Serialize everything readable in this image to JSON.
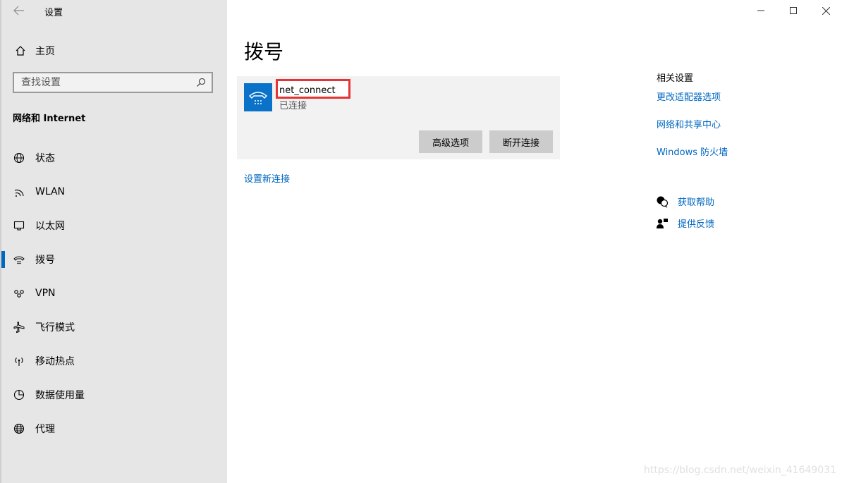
{
  "window": {
    "app_title": "设置"
  },
  "sidebar": {
    "home_label": "主页",
    "search_placeholder": "查找设置",
    "section_title": "网络和 Internet",
    "items": [
      {
        "label": "状态",
        "icon": "globe-status-icon"
      },
      {
        "label": "WLAN",
        "icon": "wifi-icon"
      },
      {
        "label": "以太网",
        "icon": "ethernet-icon"
      },
      {
        "label": "拨号",
        "icon": "dialup-icon",
        "active": true
      },
      {
        "label": "VPN",
        "icon": "vpn-icon"
      },
      {
        "label": "飞行模式",
        "icon": "airplane-icon"
      },
      {
        "label": "移动热点",
        "icon": "hotspot-icon"
      },
      {
        "label": "数据使用量",
        "icon": "data-usage-icon"
      },
      {
        "label": "代理",
        "icon": "globe-proxy-icon"
      }
    ]
  },
  "main": {
    "title": "拨号",
    "connection": {
      "name": "net_connect",
      "status": "已连接",
      "advanced_button": "高级选项",
      "disconnect_button": "断开连接"
    },
    "new_connection_link": "设置新连接"
  },
  "related": {
    "title": "相关设置",
    "links": [
      "更改适配器选项",
      "网络和共享中心",
      "Windows 防火墙"
    ]
  },
  "help": {
    "get_help": "获取帮助",
    "feedback": "提供反馈"
  },
  "watermark": "https://blog.csdn.net/weixin_41649031",
  "colors": {
    "accent": "#0067c0",
    "sidebar_bg": "#e6e6e6",
    "card_bg": "#f2f2f2",
    "highlight": "#e63333",
    "conn_icon_bg": "#0a73c9"
  }
}
